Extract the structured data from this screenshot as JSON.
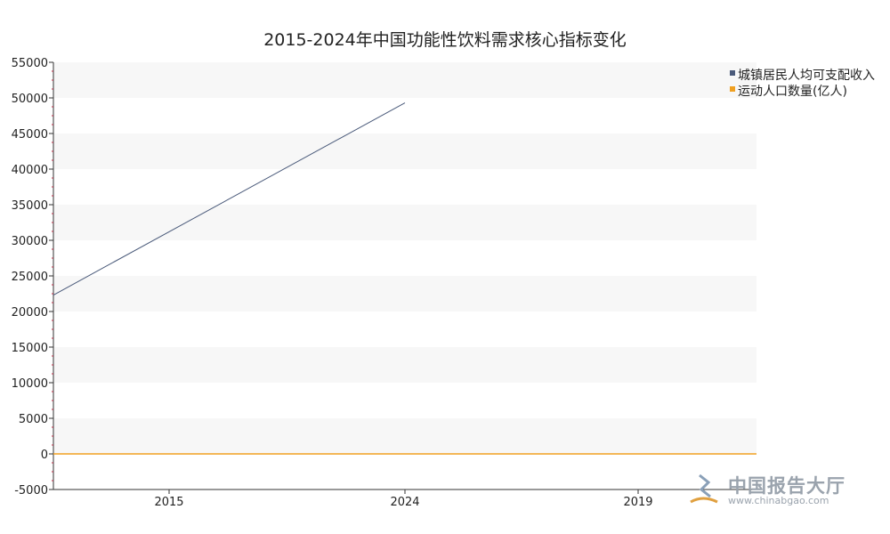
{
  "chart_data": {
    "type": "line",
    "title": "2015-2024年中国功能性饮料需求核心指标变化",
    "categories": [
      "2015",
      "2024",
      "2019"
    ],
    "x_tick_labels": [
      "2015",
      "2024",
      "2019"
    ],
    "ylim": [
      -5000,
      55000
    ],
    "y_ticks": [
      -5000,
      0,
      5000,
      10000,
      15000,
      20000,
      25000,
      30000,
      35000,
      40000,
      45000,
      50000,
      55000
    ],
    "grid": "alternating horizontal bands",
    "legend_position": "top-right",
    "series": [
      {
        "name": "城镇居民人均可支配收入",
        "color": "#4a5a7a",
        "values": [
          31195,
          49302,
          null
        ]
      },
      {
        "name": "运动人口数量(亿人)",
        "color": "#f0a020",
        "values": [
          3.6,
          5.0,
          4.3
        ]
      }
    ]
  },
  "watermark": {
    "text": "中国报告大厅",
    "url": "www.chinabgao.com"
  }
}
